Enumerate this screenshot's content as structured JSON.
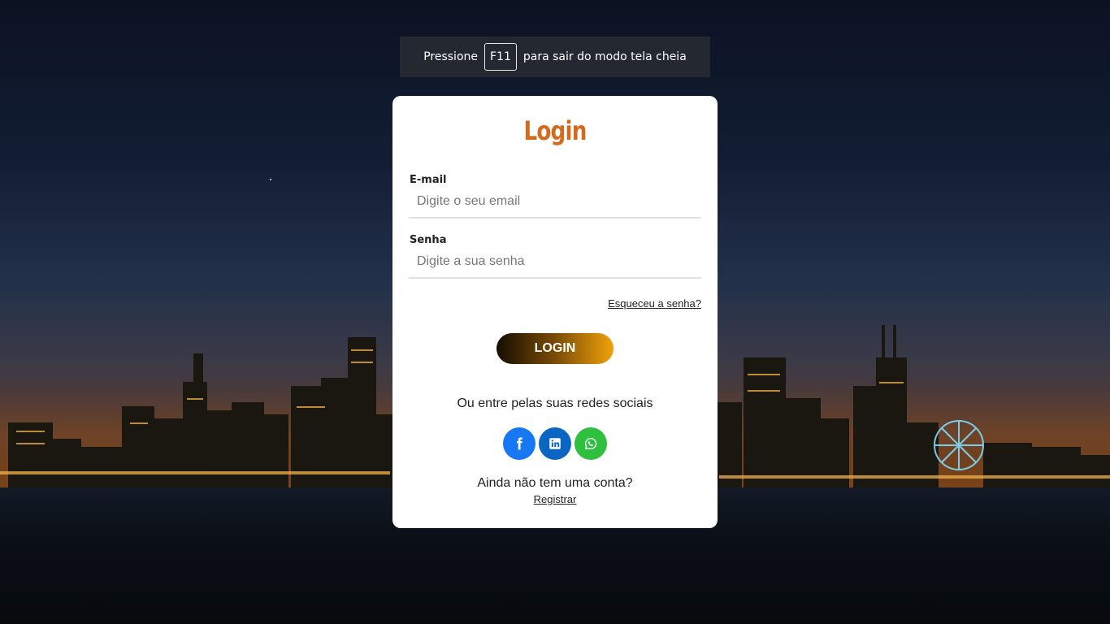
{
  "fullscreen_banner": {
    "before": "Pressione",
    "key": "F11",
    "after": "para sair do modo tela cheia"
  },
  "login_card": {
    "title": "Login",
    "email": {
      "label": "E-mail",
      "placeholder": "Digite o seu email",
      "value": ""
    },
    "password": {
      "label": "Senha",
      "placeholder": "Digite a sua senha",
      "value": ""
    },
    "forgot_link": "Esqueceu a senha?",
    "login_button": "LOGIN",
    "social_text": "Ou entre pelas suas redes sociais",
    "social_buttons": [
      {
        "name": "facebook",
        "icon": "facebook-icon",
        "color": "#1877f2"
      },
      {
        "name": "linkedin",
        "icon": "linkedin-icon",
        "color": "#0a66c2"
      },
      {
        "name": "whatsapp",
        "icon": "whatsapp-icon",
        "color": "#2fc03f"
      }
    ],
    "signup_text": "Ainda não tem uma conta?",
    "signup_link": "Registrar"
  },
  "colors": {
    "title": "#d26b1f",
    "button_gradient_start": "#150d02",
    "button_gradient_end": "#f0a20a"
  }
}
